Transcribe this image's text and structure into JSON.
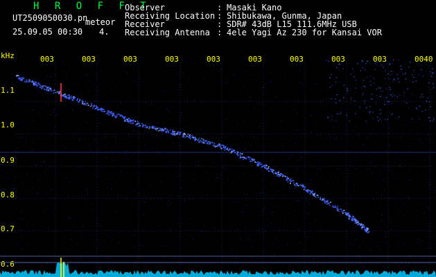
{
  "header": {
    "brand": "H R O F F T",
    "filename": "UT2509050030.pn",
    "mode": "meteor",
    "timestamp": "25.09.05 00:30",
    "count": "4."
  },
  "metadata": [
    {
      "label": "Observer",
      "value": "Masaki Kano"
    },
    {
      "label": "Receiving Location",
      "value": "Shibukawa, Gunma, Japan"
    },
    {
      "label": "Receiver",
      "value": "SDR# 43dB L15 111.6MHz USB"
    },
    {
      "label": "Receiving Antenna",
      "value": "4ele Yagi Az 230 for Kansai VOR"
    }
  ],
  "colors": {
    "background": "#000000",
    "brand": "#00ff40",
    "axis_text": "#ffff00",
    "echo": "#4060ff",
    "spectrum": "#00c8ff",
    "grid": "#1a2a6a"
  },
  "chart_data": {
    "type": "heatmap",
    "ylabel": "kHz",
    "ylim": [
      0.6,
      1.2
    ],
    "yticks": [
      "1.1",
      "1.0",
      "0.9",
      "0.8",
      "0.7",
      "0.6"
    ],
    "time_ticks": [
      "003",
      "003",
      "003",
      "003",
      "003",
      "003",
      "003",
      "003",
      "003",
      "0040"
    ],
    "grid": true,
    "echo_trace": [
      {
        "x": 0.0,
        "y": 1.18
      },
      {
        "x": 0.1,
        "y": 1.13
      },
      {
        "x": 0.2,
        "y": 1.08
      },
      {
        "x": 0.3,
        "y": 1.03
      },
      {
        "x": 0.4,
        "y": 1.0
      },
      {
        "x": 0.5,
        "y": 0.96
      },
      {
        "x": 0.6,
        "y": 0.9
      },
      {
        "x": 0.7,
        "y": 0.83
      },
      {
        "x": 0.8,
        "y": 0.75
      },
      {
        "x": 0.85,
        "y": 0.7
      }
    ]
  }
}
